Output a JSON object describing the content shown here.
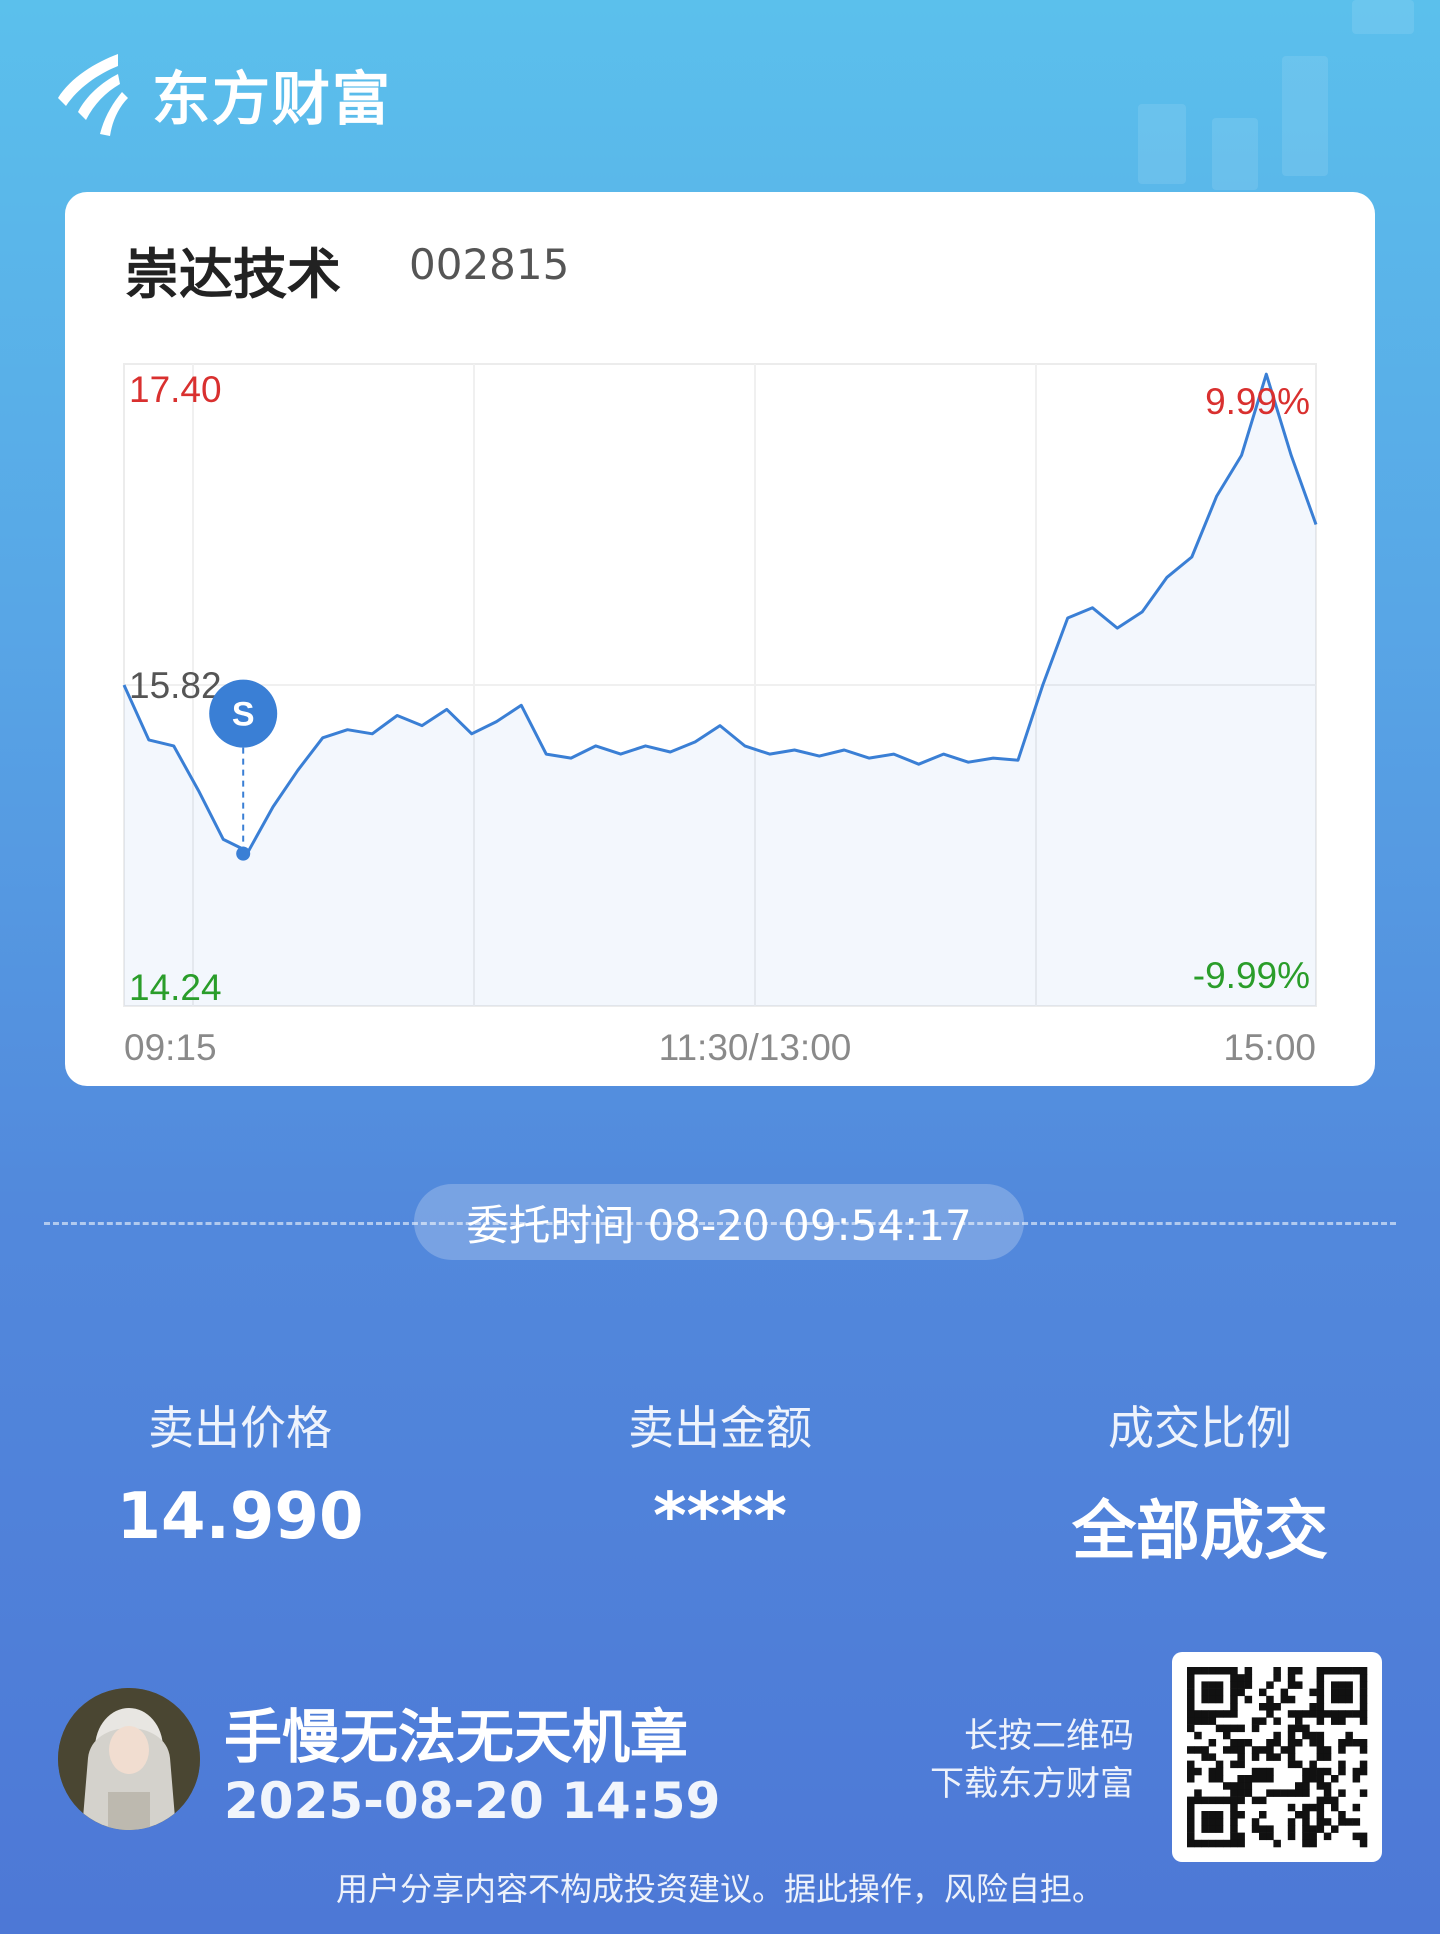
{
  "brand": {
    "name": "东方财富",
    "logo_icon": "eastmoney-logo-icon"
  },
  "stock": {
    "name": "崇达技术",
    "code": "002815"
  },
  "chart_data": {
    "type": "line",
    "series_color": "#3a7fd5",
    "y_ticks": {
      "top": "17.40",
      "mid": "15.82",
      "bottom": "14.24"
    },
    "pct_ticks": {
      "top": "9.99%",
      "bottom": "-9.99%"
    },
    "x_ticks": [
      "09:15",
      "11:30/13:00",
      "15:00"
    ],
    "top_color": "#d9302f",
    "bottom_color": "#2a9d2a",
    "ylim": [
      14.24,
      17.4
    ],
    "prev_close": 15.82,
    "x": [
      "09:30",
      "09:35",
      "09:40",
      "09:45",
      "09:50",
      "09:55",
      "10:00",
      "10:05",
      "10:10",
      "10:15",
      "10:20",
      "10:25",
      "10:30",
      "10:35",
      "10:40",
      "10:45",
      "10:50",
      "10:55",
      "11:00",
      "11:05",
      "11:10",
      "11:15",
      "11:20",
      "11:25",
      "11:30",
      "13:05",
      "13:10",
      "13:15",
      "13:20",
      "13:25",
      "13:30",
      "13:35",
      "13:40",
      "13:45",
      "13:50",
      "13:55",
      "14:00",
      "14:05",
      "14:10",
      "14:15",
      "14:20",
      "14:25",
      "14:30",
      "14:35",
      "14:40",
      "14:45",
      "14:50",
      "14:55",
      "15:00"
    ],
    "values": [
      15.82,
      15.55,
      15.52,
      15.3,
      15.06,
      15.0,
      15.22,
      15.4,
      15.56,
      15.6,
      15.58,
      15.67,
      15.62,
      15.7,
      15.58,
      15.64,
      15.72,
      15.48,
      15.46,
      15.52,
      15.48,
      15.52,
      15.49,
      15.54,
      15.62,
      15.52,
      15.48,
      15.5,
      15.47,
      15.5,
      15.46,
      15.48,
      15.43,
      15.48,
      15.44,
      15.46,
      15.45,
      15.82,
      16.15,
      16.2,
      16.1,
      16.18,
      16.35,
      16.45,
      16.75,
      16.95,
      17.35,
      16.95,
      16.61
    ],
    "marker": {
      "label": "S",
      "time": "09:54",
      "price": 14.99,
      "color": "#3a7fd5"
    }
  },
  "order_time": {
    "text": "委托时间 08-20 09:54:17"
  },
  "stats": [
    {
      "label": "卖出价格",
      "value": "14.990"
    },
    {
      "label": "卖出金额",
      "value": "****"
    },
    {
      "label": "成交比例",
      "value": "全部成交"
    }
  ],
  "user": {
    "name": "手慢无法无天机章",
    "share_time": "2025-08-20 14:59",
    "avatar_icon": "user-avatar"
  },
  "qr": {
    "hint_line1": "长按二维码",
    "hint_line2": "下载东方财富",
    "icon": "qr-code-icon"
  },
  "disclaimer": "用户分享内容不构成投资建议。据此操作，风险自担。"
}
